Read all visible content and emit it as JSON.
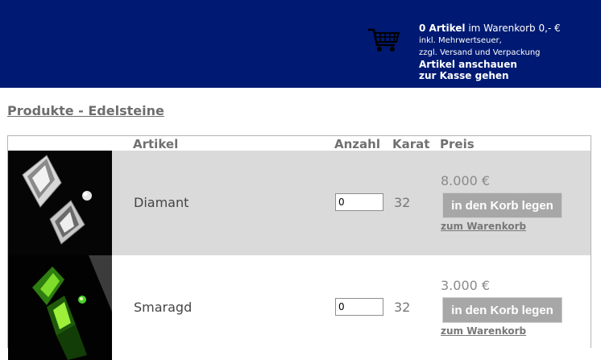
{
  "header": {
    "cart_icon": "shopping-cart-icon",
    "cart_count": "0 Artikel",
    "cart_text": " im Warenkorb 0,- €",
    "tax_note": "inkl. Mehrwertseuer,",
    "shipping_note": "zzgl. Versand und Verpackung",
    "view_link": "Artikel anschauen",
    "checkout_link": "zur Kasse gehen"
  },
  "page_title": "Produkte - Edelsteine",
  "table": {
    "headers": [
      "Artikel",
      "Anzahl",
      "Karat",
      "Preis"
    ],
    "rows": [
      {
        "name": "Diamant",
        "quantity": "0",
        "karat": "32",
        "price": "8.000 €",
        "add_label": "in den Korb legen",
        "cart_link": "zum Warenkorb"
      },
      {
        "name": "Smaragd",
        "quantity": "0",
        "karat": "32",
        "price": "3.000 €",
        "add_label": "in den Korb legen",
        "cart_link": "zum Warenkorb"
      }
    ]
  },
  "colors": {
    "header_bg": "#001a73",
    "row_alt_bg": "#dadada",
    "button_bg": "#a7a7a7"
  }
}
